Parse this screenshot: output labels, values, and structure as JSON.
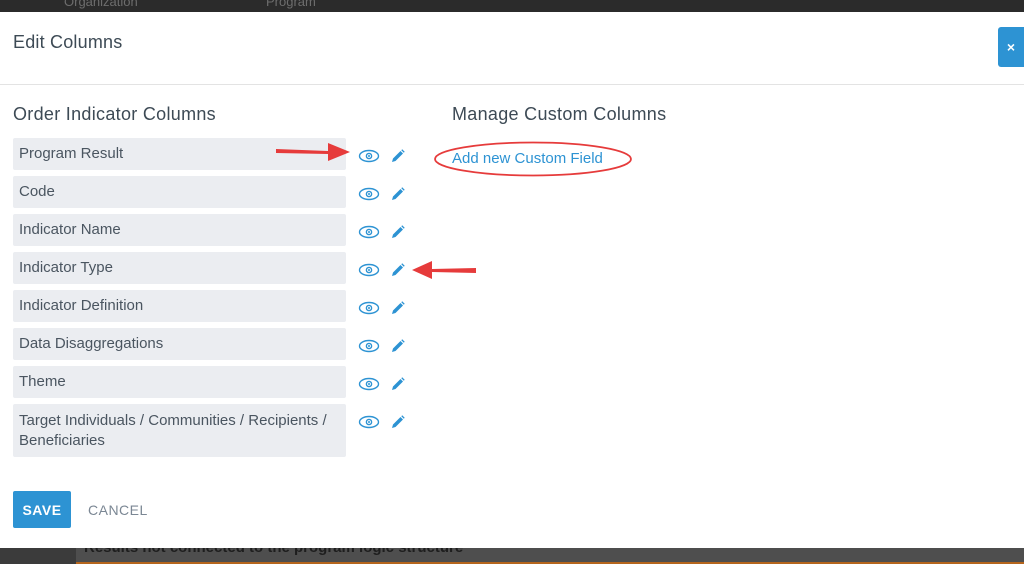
{
  "background": {
    "nav_labels": [
      "Organization",
      "Program"
    ],
    "bottom_banner": "Results not connected to the program logic structure"
  },
  "modal": {
    "title": "Edit Columns",
    "close_label": "×"
  },
  "left_section": {
    "title": "Order Indicator Columns",
    "columns": [
      {
        "label": "Program Result"
      },
      {
        "label": "Code"
      },
      {
        "label": "Indicator Name"
      },
      {
        "label": "Indicator Type"
      },
      {
        "label": "Indicator Definition"
      },
      {
        "label": "Data Disaggregations"
      },
      {
        "label": "Theme"
      },
      {
        "label": "Target Individuals / Communities / Recipients / Beneficiaries"
      }
    ]
  },
  "right_section": {
    "title": "Manage Custom Columns",
    "add_link": "Add new Custom Field"
  },
  "footer": {
    "save_label": "SAVE",
    "cancel_label": "CANCEL"
  },
  "colors": {
    "accent": "#2d93d3",
    "annotation": "#e63b3b",
    "row_bg": "#ebedf1"
  },
  "icons": [
    "eye-icon",
    "pencil-icon",
    "close-icon",
    "arrow-annotation"
  ]
}
